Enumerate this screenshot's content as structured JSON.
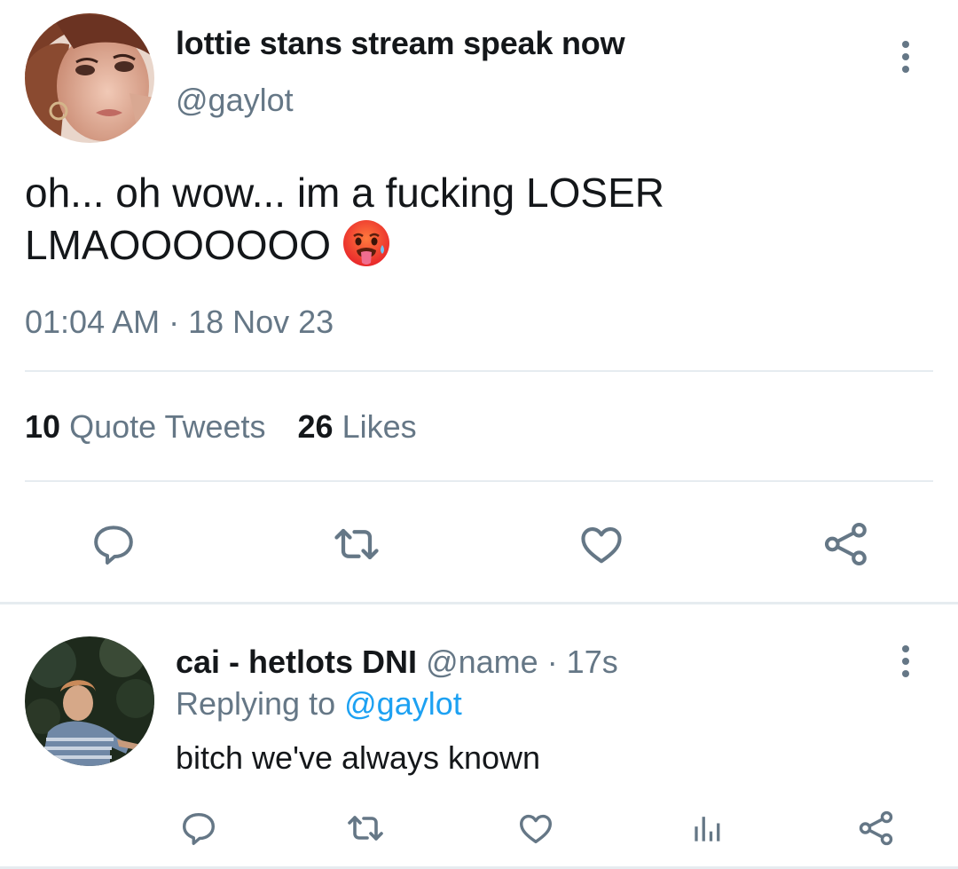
{
  "main_tweet": {
    "author": {
      "display_name": "lottie stans stream speak now",
      "handle": "@gaylot"
    },
    "text_line1": "oh... oh wow... im a fucking LOSER",
    "text_line2": "LMAOOOOOOO",
    "emoji": "hot-face-with-tongue-emoji",
    "timestamp": "01:04 AM · 18 Nov 23",
    "stats": {
      "quote_count": "10",
      "quote_label": "Quote Tweets",
      "likes_count": "26",
      "likes_label": "Likes"
    },
    "actions": [
      "reply-icon",
      "retweet-icon",
      "like-icon",
      "share-icon"
    ]
  },
  "reply_tweet": {
    "author": {
      "display_name": "cai - hetlots DNI",
      "handle": "@name",
      "time": "· 17s"
    },
    "replying_prefix": "Replying to",
    "replying_to": "@gaylot",
    "text": "bitch we've always known",
    "actions": [
      "reply-icon",
      "retweet-icon",
      "like-icon",
      "analytics-icon",
      "share-icon"
    ]
  },
  "colors": {
    "text": "#14171a",
    "secondary": "#657786",
    "accent": "#1da1f2",
    "divider": "#e6ecf0"
  }
}
